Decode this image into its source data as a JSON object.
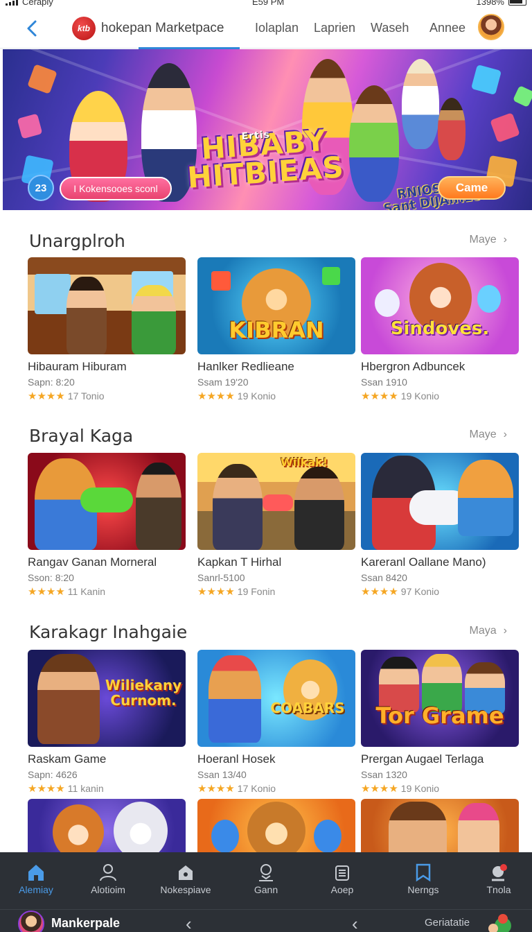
{
  "status_bar": {
    "carrier": "Cerapiy",
    "time": "E59 PM",
    "battery": "1398%"
  },
  "top_nav": {
    "brand_title": "hokepan Marketpace",
    "brand_logo_text": "ktb",
    "tabs": [
      "Iolaplan",
      "Laprien",
      "Waseh",
      "Annee"
    ]
  },
  "hero": {
    "title_small": "Ertis",
    "title_line1": "HIBABY",
    "title_line2": "HITBIEAS",
    "subtitle_line1": "RNIOSRGE",
    "subtitle_line2": "Sant DIJAIHES:",
    "badge": "23",
    "pill_label": "I Kokensooes sconl",
    "cta_label": "Came"
  },
  "sections": [
    {
      "title": "Unargplroh",
      "more_label": "Maye",
      "cards": [
        {
          "name": "Hibauram Hiburam",
          "sales": "Sapn: 8:20",
          "stars": "★★★★",
          "rating": "17 Tonio",
          "art": "diner"
        },
        {
          "name": "Hanlker Redlieane",
          "sales": "Ssam 19'20",
          "stars": "★★★★",
          "rating": "19 Konio",
          "art_text": "KIBRAN"
        },
        {
          "name": "Hbergron Adbuncek",
          "sales": "Ssan 1910",
          "stars": "★★★★",
          "rating": "19 Konio",
          "art_text": "Sindoves."
        }
      ]
    },
    {
      "title": "Brayal Kaga",
      "more_label": "Maye",
      "cards": [
        {
          "name": "Rangav Ganan Morneral",
          "sales": "Sson: 8:20",
          "stars": "★★★★",
          "rating": "11 Kanin"
        },
        {
          "name": "Kapkan T Hirhal",
          "sales": "Sanrl-5100",
          "stars": "★★★★",
          "rating": "19 Fonin",
          "art_text": "Wilkak!"
        },
        {
          "name": "Kareranl Oallane Mano)",
          "sales": "Ssan 8420",
          "stars": "★★★★",
          "rating": "97 Konio"
        }
      ]
    },
    {
      "title": "Karakagr Inahgaie",
      "more_label": "Maya",
      "cards": [
        {
          "name": "Raskam Game",
          "sales": "Sapn: 4626",
          "stars": "★★★★",
          "rating": "11 kanin",
          "art_text": "Wiliekany Curnom."
        },
        {
          "name": "Hoeranl Hosek",
          "sales": "Ssan 13/40",
          "stars": "★★★★",
          "rating": "17 Konio",
          "art_text": "COABARS"
        },
        {
          "name": "Prergan Augael Terlaga",
          "sales": "Ssan 1320",
          "stars": "★★★★",
          "rating": "19 Konio",
          "art_text": "Tor Grame"
        }
      ]
    }
  ],
  "bottom_nav": {
    "items": [
      {
        "label": "Alemiay",
        "icon": "home-icon"
      },
      {
        "label": "Alotioim",
        "icon": "user-icon"
      },
      {
        "label": "Nokespiave",
        "icon": "store-icon"
      },
      {
        "label": "Gann",
        "icon": "person-icon"
      },
      {
        "label": "Aoep",
        "icon": "list-icon"
      },
      {
        "label": "Nerngs",
        "icon": "bookmark-icon"
      },
      {
        "label": "Tnola",
        "icon": "chat-icon"
      }
    ],
    "app_label": "Mankerpale",
    "right_label": "Geriatatie"
  },
  "colors": {
    "accent": "#2f86d8",
    "star": "#f5a623",
    "bottom_bar": "#2c3036",
    "cta": "#ff7a1e"
  }
}
